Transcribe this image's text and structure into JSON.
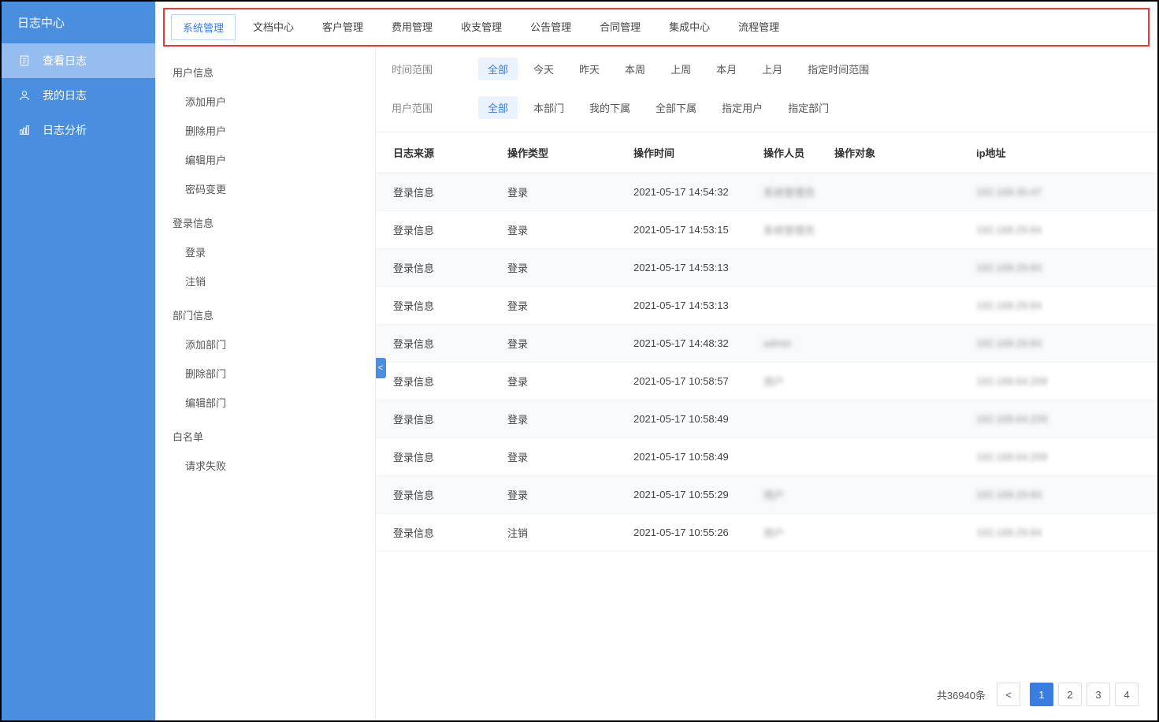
{
  "sidebar": {
    "title": "日志中心",
    "items": [
      {
        "label": "查看日志",
        "active": true,
        "icon": "document"
      },
      {
        "label": "我的日志",
        "active": false,
        "icon": "user"
      },
      {
        "label": "日志分析",
        "active": false,
        "icon": "chart"
      }
    ]
  },
  "topTabs": [
    {
      "label": "系统管理",
      "active": true
    },
    {
      "label": "文档中心",
      "active": false
    },
    {
      "label": "客户管理",
      "active": false
    },
    {
      "label": "费用管理",
      "active": false
    },
    {
      "label": "收支管理",
      "active": false
    },
    {
      "label": "公告管理",
      "active": false
    },
    {
      "label": "合同管理",
      "active": false
    },
    {
      "label": "集成中心",
      "active": false
    },
    {
      "label": "流程管理",
      "active": false
    }
  ],
  "tree": [
    {
      "title": "用户信息",
      "children": [
        "添加用户",
        "删除用户",
        "编辑用户",
        "密码变更"
      ]
    },
    {
      "title": "登录信息",
      "children": [
        "登录",
        "注销"
      ]
    },
    {
      "title": "部门信息",
      "children": [
        "添加部门",
        "删除部门",
        "编辑部门"
      ]
    },
    {
      "title": "白名单",
      "children": [
        "请求失败"
      ]
    }
  ],
  "filters": {
    "timeRange": {
      "label": "时间范围",
      "options": [
        "全部",
        "今天",
        "昨天",
        "本周",
        "上周",
        "本月",
        "上月",
        "指定时间范围"
      ],
      "active": 0
    },
    "userRange": {
      "label": "用户范围",
      "options": [
        "全部",
        "本部门",
        "我的下属",
        "全部下属",
        "指定用户",
        "指定部门"
      ],
      "active": 0
    }
  },
  "table": {
    "headers": [
      "日志来源",
      "操作类型",
      "操作时间",
      "操作人员",
      "操作对象",
      "ip地址"
    ],
    "rows": [
      {
        "source": "登录信息",
        "type": "登录",
        "time": "2021-05-17 14:54:32",
        "person": "系统管理员",
        "target": "",
        "ip": "192.168.30.47"
      },
      {
        "source": "登录信息",
        "type": "登录",
        "time": "2021-05-17 14:53:15",
        "person": "系统管理员",
        "target": "",
        "ip": "192.168.29.84"
      },
      {
        "source": "登录信息",
        "type": "登录",
        "time": "2021-05-17 14:53:13",
        "person": "",
        "target": "",
        "ip": "192.168.29.84"
      },
      {
        "source": "登录信息",
        "type": "登录",
        "time": "2021-05-17 14:53:13",
        "person": "",
        "target": "",
        "ip": "192.168.29.84"
      },
      {
        "source": "登录信息",
        "type": "登录",
        "time": "2021-05-17 14:48:32",
        "person": "admin",
        "target": "",
        "ip": "192.168.29.84"
      },
      {
        "source": "登录信息",
        "type": "登录",
        "time": "2021-05-17 10:58:57",
        "person": "用户",
        "target": "",
        "ip": "192.168.64.209"
      },
      {
        "source": "登录信息",
        "type": "登录",
        "time": "2021-05-17 10:58:49",
        "person": "",
        "target": "",
        "ip": "192.168.64.209"
      },
      {
        "source": "登录信息",
        "type": "登录",
        "time": "2021-05-17 10:58:49",
        "person": "",
        "target": "",
        "ip": "192.168.64.209"
      },
      {
        "source": "登录信息",
        "type": "登录",
        "time": "2021-05-17 10:55:29",
        "person": "用户",
        "target": "",
        "ip": "192.168.29.84"
      },
      {
        "source": "登录信息",
        "type": "注销",
        "time": "2021-05-17 10:55:26",
        "person": "用户",
        "target": "",
        "ip": "192.168.29.84"
      }
    ]
  },
  "pagination": {
    "totalText": "共36940条",
    "prev": "<",
    "pages": [
      "1",
      "2",
      "3",
      "4"
    ],
    "active": 0
  },
  "collapseGlyph": "<"
}
